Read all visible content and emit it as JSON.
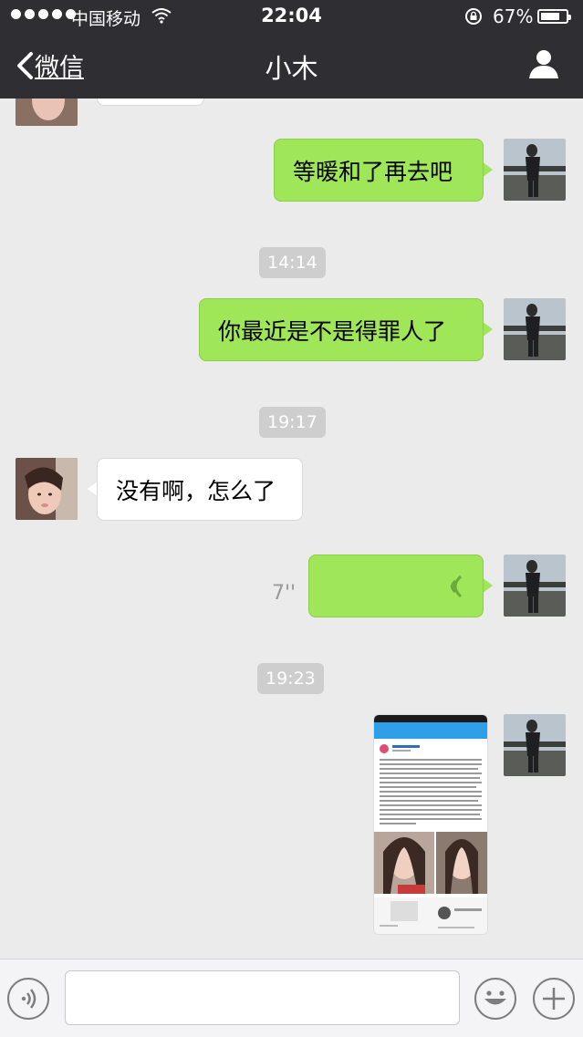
{
  "status_bar": {
    "carrier": "中国移动",
    "time": "22:04",
    "battery": "67%"
  },
  "nav": {
    "back_label": "微信",
    "title": "小木",
    "icons": {
      "back": "chevron-left-icon",
      "profile": "person-icon"
    }
  },
  "colors": {
    "nav_bg": "#2e2e33",
    "bubble_out": "#9fe658",
    "bubble_in": "#ffffff",
    "chat_bg": "#ebebeb"
  },
  "messages": [
    {
      "type": "text",
      "dir": "out",
      "text": "等暖和了再去吧"
    },
    {
      "type": "timestamp",
      "text": "14:14"
    },
    {
      "type": "text",
      "dir": "out",
      "text": "你最近是不是得罪人了"
    },
    {
      "type": "timestamp",
      "text": "19:17"
    },
    {
      "type": "text",
      "dir": "in",
      "text": "没有啊，怎么了"
    },
    {
      "type": "voice",
      "dir": "out",
      "duration": "7''"
    },
    {
      "type": "timestamp",
      "text": "19:23"
    },
    {
      "type": "image",
      "dir": "out"
    }
  ],
  "input_bar": {
    "icons": {
      "voice": "voice-icon",
      "emoji": "emoji-icon",
      "plus": "plus-icon"
    }
  }
}
